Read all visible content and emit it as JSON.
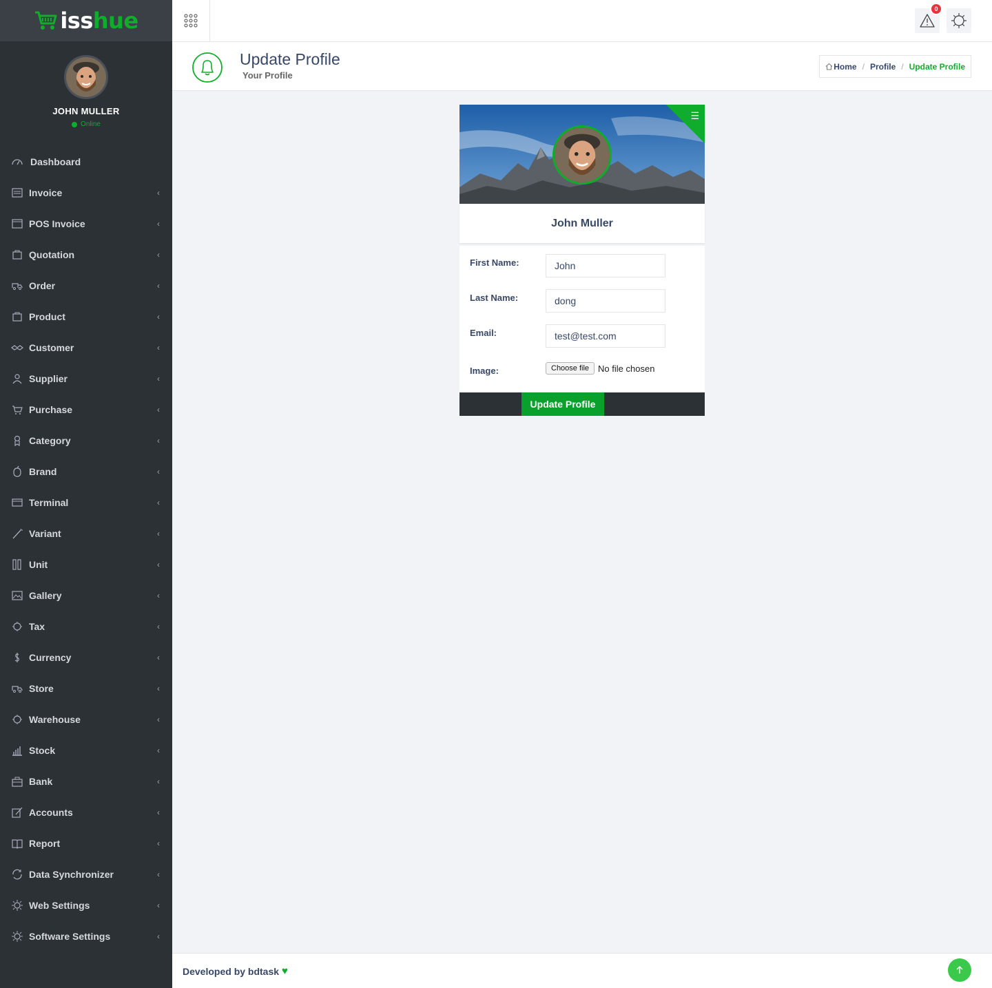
{
  "brand": {
    "part1": "iss",
    "part2": "hue"
  },
  "user": {
    "name": "JOHN MULLER",
    "status": "Online"
  },
  "sidebar": {
    "items": [
      {
        "label": "Dashboard",
        "icon": "dashboard-icon",
        "chevron": false
      },
      {
        "label": "Invoice",
        "icon": "invoice-icon",
        "chevron": true
      },
      {
        "label": "POS Invoice",
        "icon": "pos-invoice-icon",
        "chevron": true
      },
      {
        "label": "Quotation",
        "icon": "quotation-icon",
        "chevron": true
      },
      {
        "label": "Order",
        "icon": "order-icon",
        "chevron": true
      },
      {
        "label": "Product",
        "icon": "product-icon",
        "chevron": true
      },
      {
        "label": "Customer",
        "icon": "customer-icon",
        "chevron": true
      },
      {
        "label": "Supplier",
        "icon": "supplier-icon",
        "chevron": true
      },
      {
        "label": "Purchase",
        "icon": "purchase-icon",
        "chevron": true
      },
      {
        "label": "Category",
        "icon": "category-icon",
        "chevron": true
      },
      {
        "label": "Brand",
        "icon": "brand-icon",
        "chevron": true
      },
      {
        "label": "Terminal",
        "icon": "terminal-icon",
        "chevron": true
      },
      {
        "label": "Variant",
        "icon": "variant-icon",
        "chevron": true
      },
      {
        "label": "Unit",
        "icon": "unit-icon",
        "chevron": true
      },
      {
        "label": "Gallery",
        "icon": "gallery-icon",
        "chevron": true
      },
      {
        "label": "Tax",
        "icon": "tax-icon",
        "chevron": true
      },
      {
        "label": "Currency",
        "icon": "currency-icon",
        "chevron": true
      },
      {
        "label": "Store",
        "icon": "store-icon",
        "chevron": true
      },
      {
        "label": "Warehouse",
        "icon": "warehouse-icon",
        "chevron": true
      },
      {
        "label": "Stock",
        "icon": "stock-icon",
        "chevron": true
      },
      {
        "label": "Bank",
        "icon": "bank-icon",
        "chevron": true
      },
      {
        "label": "Accounts",
        "icon": "accounts-icon",
        "chevron": true
      },
      {
        "label": "Report",
        "icon": "report-icon",
        "chevron": true
      },
      {
        "label": "Data Synchronizer",
        "icon": "sync-icon",
        "chevron": true
      },
      {
        "label": "Web Settings",
        "icon": "web-settings-icon",
        "chevron": true
      },
      {
        "label": "Software Settings",
        "icon": "software-settings-icon",
        "chevron": true
      }
    ]
  },
  "header": {
    "notification_count": "0"
  },
  "page": {
    "title": "Update Profile",
    "subtitle": "Your Profile",
    "breadcrumb": {
      "home": "Home",
      "profile": "Profile",
      "current": "Update Profile"
    }
  },
  "profile": {
    "display_name": "John Muller",
    "form": {
      "first_name_label": "First Name:",
      "first_name_value": "John",
      "last_name_label": "Last Name:",
      "last_name_value": "dong",
      "email_label": "Email:",
      "email_value": "test@test.com",
      "image_label": "Image:",
      "file_button": "Choose file",
      "file_status": "No file chosen",
      "submit_label": "Update Profile"
    }
  },
  "footer": {
    "text": "Developed by bdtask"
  },
  "colors": {
    "accent": "#0fad2b",
    "sidebar": "#2c3136",
    "badge": "#e5343d"
  }
}
